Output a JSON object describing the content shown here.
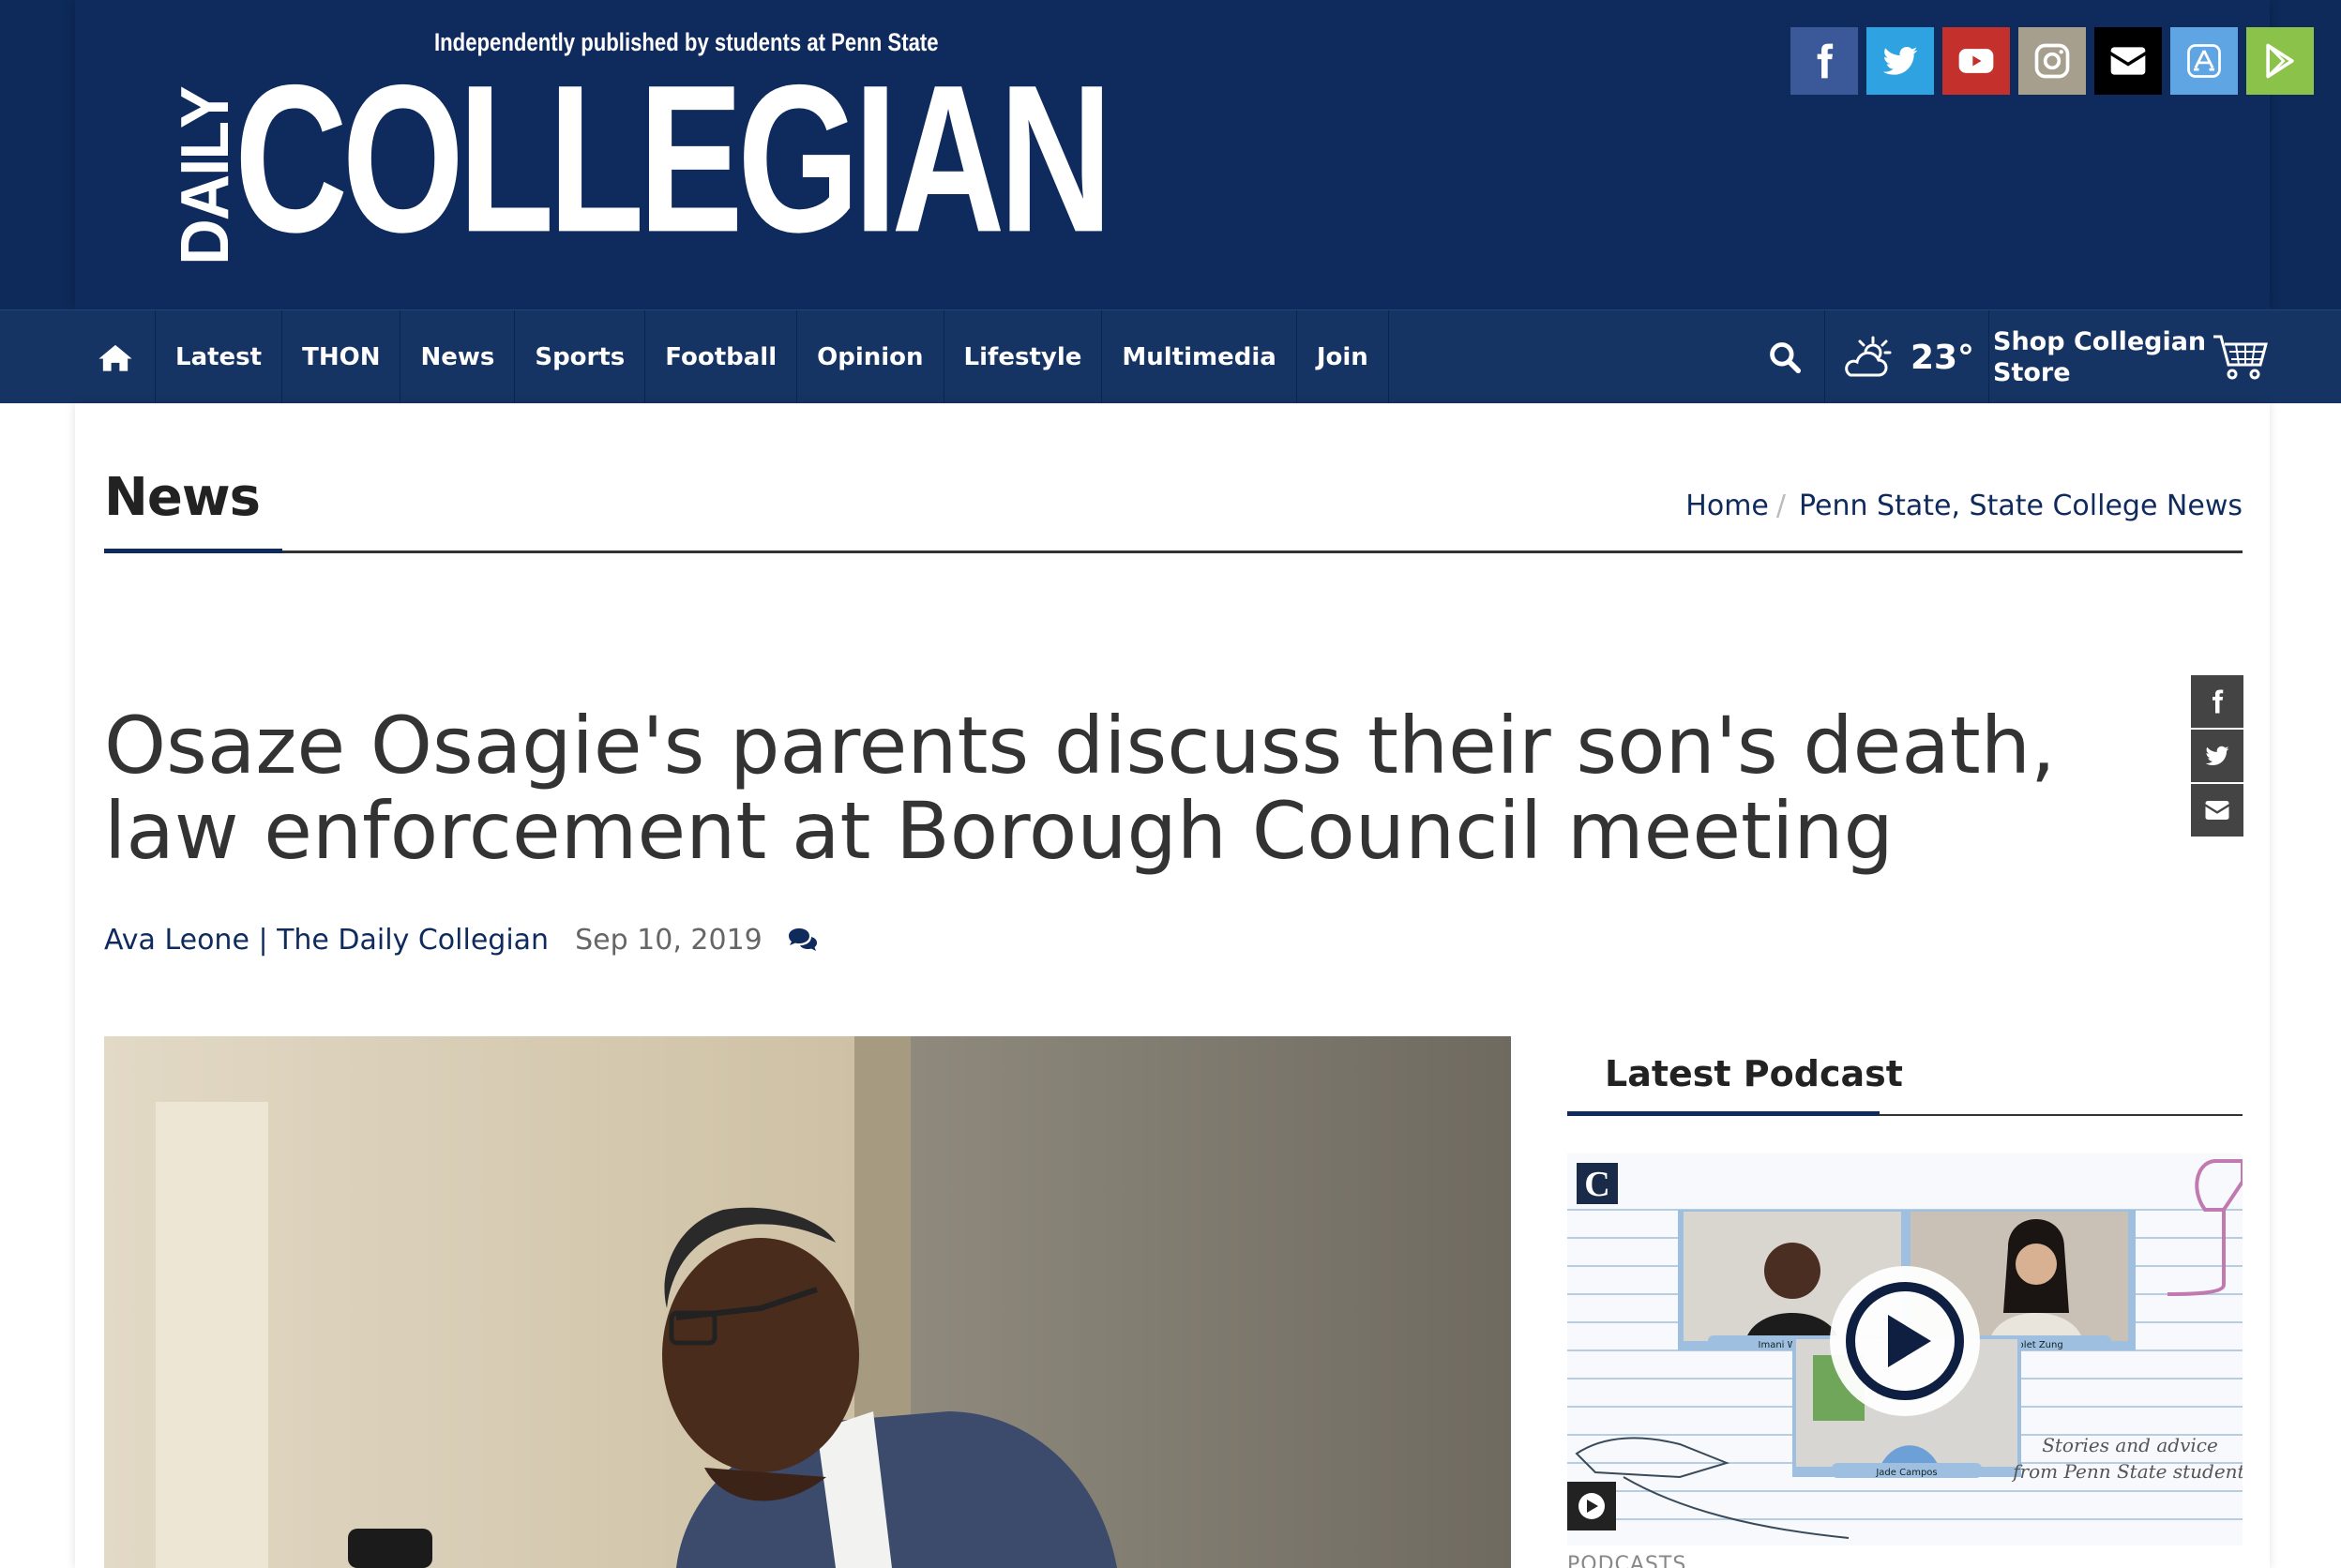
{
  "header": {
    "tagline": "Independently published by students at Penn State",
    "logo_daily": "DAILY",
    "logo_collegian": "COLLEGIAN",
    "social": [
      {
        "icon": "facebook-icon",
        "color": "#3b5998"
      },
      {
        "icon": "twitter-icon",
        "color": "#2fa3e2"
      },
      {
        "icon": "youtube-icon",
        "color": "#c4302b"
      },
      {
        "icon": "instagram-icon",
        "color": "#a69f8e"
      },
      {
        "icon": "email-icon",
        "color": "#000000"
      },
      {
        "icon": "app-store-icon",
        "color": "#5fa5e3"
      },
      {
        "icon": "google-play-icon",
        "color": "#8bc34a"
      }
    ]
  },
  "nav": {
    "items": [
      "Latest",
      "THON",
      "News",
      "Sports",
      "Football",
      "Opinion",
      "Lifestyle",
      "Multimedia",
      "Join"
    ],
    "weather_temp": "23°",
    "shop_line1": "Shop Collegian",
    "shop_line2": "Store"
  },
  "section": {
    "title": "News",
    "breadcrumb": [
      "Home",
      "Penn State, State College News"
    ]
  },
  "article": {
    "headline": "Osaze Osagie's parents discuss their son's death, law enforcement at Borough Council meeting",
    "author": "Ava Leone | The Daily Collegian",
    "date": "Sep 10, 2019"
  },
  "sidebar": {
    "podcast_title": "Latest Podcast",
    "podcast_logo": "C",
    "participants": [
      "Imani Williams",
      "Violet Zung",
      "Jade Campos"
    ],
    "tagline_1": "Stories and advice",
    "tagline_2": "from Penn State students",
    "more_label": "PODCASTS"
  },
  "colors": {
    "brand_navy": "#0f2b5d",
    "nav_bg": "#163463"
  }
}
